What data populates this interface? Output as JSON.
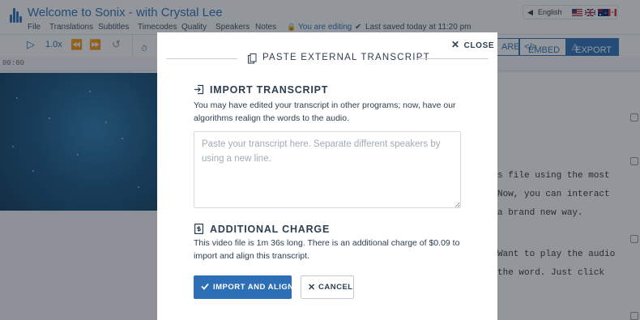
{
  "app": {
    "title": "Welcome to Sonix - with Crystal Lee",
    "language": "English",
    "menu": [
      "File",
      "Translations",
      "Subtitles",
      "Timecodes",
      "Quality",
      "Speakers",
      "Notes"
    ],
    "editing_status": "You are editing",
    "saved_status": "Last saved today at 11:20 pm",
    "speed": "1.0x",
    "ruler_time": "00:00",
    "share_label": "ARE",
    "embed_label": "EMBED",
    "export_label": "EXPORT",
    "transcript_lines": [
      "s file using the most",
      "Now, you can interact",
      "a brand new way.",
      "Want to play the audio",
      "the word. Just click"
    ],
    "accent_color": "#2c6fb6"
  },
  "modal": {
    "close_label": "CLOSE",
    "title": "PASTE EXTERNAL TRANSCRIPT",
    "import_heading": "IMPORT TRANSCRIPT",
    "import_description": "You may have edited your transcript in other programs; now, have our algorithms realign the words to the audio.",
    "textarea_placeholder": "Paste your transcript here. Separate different speakers by using a new line.",
    "charge_heading": "ADDITIONAL CHARGE",
    "charge_description": "This video file is 1m 36s long. There is an additional charge of $0.09 to import and align this transcript.",
    "import_button": "IMPORT AND ALIGN",
    "cancel_button": "CANCEL",
    "icons": {
      "title": "copy-icon",
      "import": "import-icon",
      "charge": "receipt-icon",
      "close": "close-icon",
      "confirm": "check-icon",
      "cancel": "close-icon"
    }
  }
}
